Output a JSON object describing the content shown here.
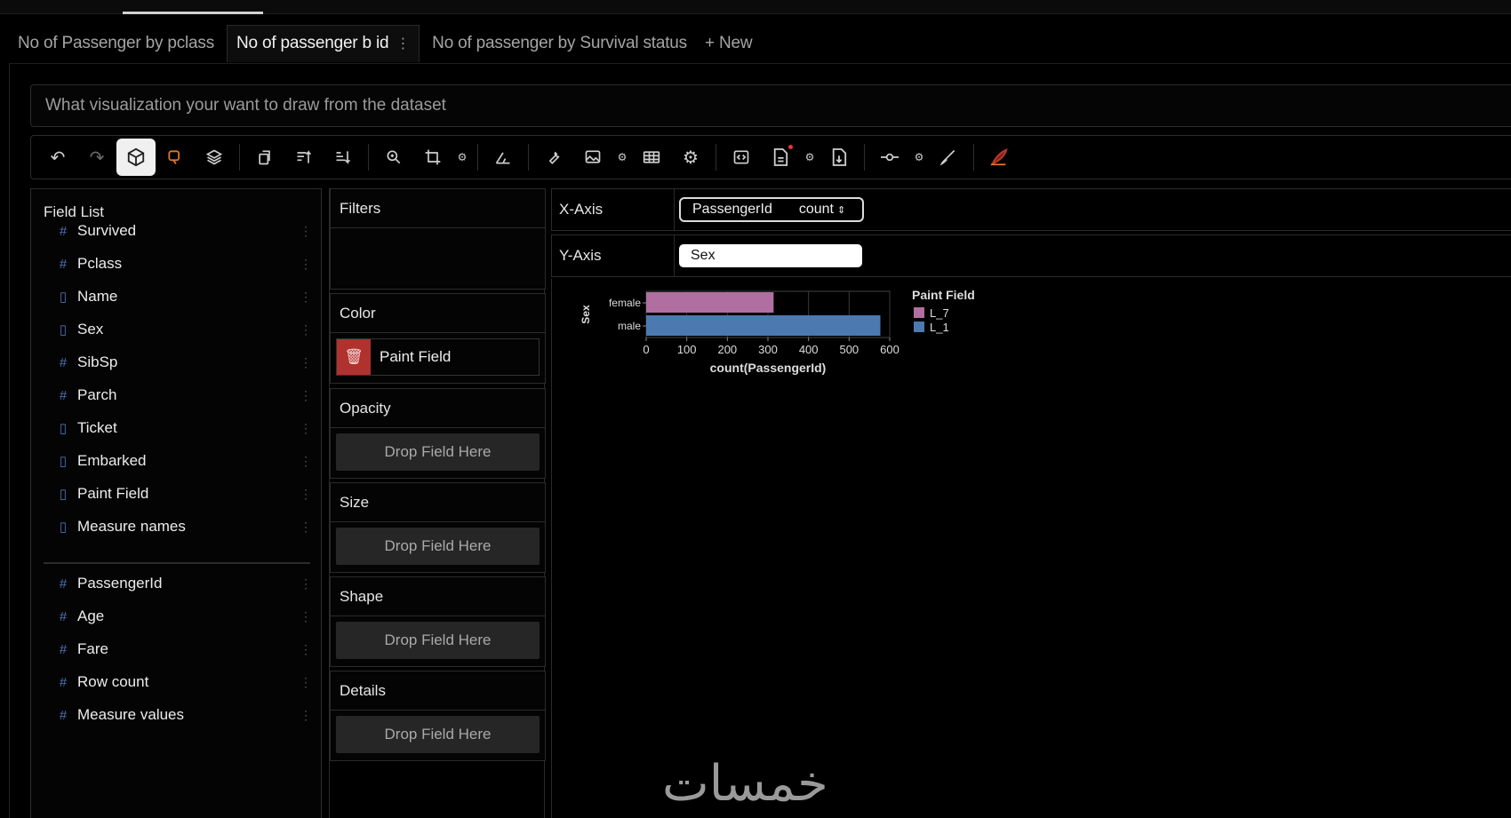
{
  "tabs": [
    {
      "label": "No of Passenger by pclass"
    },
    {
      "label": "No of passenger b id"
    },
    {
      "label": "No of passenger by Survival status"
    },
    {
      "label": "+ New"
    }
  ],
  "query": {
    "placeholder": "What visualization your want to draw from the dataset"
  },
  "toolbar": {
    "icons": [
      "undo-icon",
      "redo-icon",
      "cube-icon",
      "lasso-icon",
      "layers-icon",
      "transpose-icon",
      "sort-ascending-icon",
      "sort-descending-icon",
      "zoom-icon",
      "crop-icon",
      "axis-icon",
      "wrench-icon",
      "image-icon",
      "table-icon",
      "gear-icon",
      "code-icon",
      "export-file-icon",
      "download-file-icon",
      "line-icon",
      "paint-brush-icon",
      "feather-icon"
    ]
  },
  "field_list": {
    "title": "Field List",
    "dimensions": [
      {
        "label": "Survived",
        "icon": "hash"
      },
      {
        "label": "Pclass",
        "icon": "hash"
      },
      {
        "label": "Name",
        "icon": "doc"
      },
      {
        "label": "Sex",
        "icon": "doc"
      },
      {
        "label": "SibSp",
        "icon": "hash"
      },
      {
        "label": "Parch",
        "icon": "hash"
      },
      {
        "label": "Ticket",
        "icon": "doc"
      },
      {
        "label": "Embarked",
        "icon": "doc"
      },
      {
        "label": "Paint Field",
        "icon": "doc"
      },
      {
        "label": "Measure names",
        "icon": "doc"
      }
    ],
    "measures": [
      {
        "label": "PassengerId",
        "icon": "hash"
      },
      {
        "label": "Age",
        "icon": "hash"
      },
      {
        "label": "Fare",
        "icon": "hash"
      },
      {
        "label": "Row count",
        "icon": "hash"
      },
      {
        "label": "Measure values",
        "icon": "hash"
      }
    ]
  },
  "encodings": {
    "filters": "Filters",
    "color": "Color",
    "color_field": "Paint Field",
    "opacity": "Opacity",
    "size": "Size",
    "shape": "Shape",
    "details": "Details",
    "drop_text": "Drop Field Here"
  },
  "axes": {
    "x_label": "X-Axis",
    "x_field": "PassengerId",
    "x_agg": "count",
    "y_label": "Y-Axis",
    "y_field": "Sex"
  },
  "chart_data": {
    "type": "bar",
    "orientation": "horizontal",
    "categories": [
      "female",
      "male"
    ],
    "series": [
      {
        "name": "L_7",
        "values": [
          314,
          0
        ],
        "color": "#b06fa0"
      },
      {
        "name": "L_1",
        "values": [
          0,
          577
        ],
        "color": "#4c79b0"
      }
    ],
    "xlabel": "count(PassengerId)",
    "ylabel": "Sex",
    "xlim": [
      0,
      600
    ],
    "xticks": [
      "0",
      "100",
      "200",
      "300",
      "400",
      "500",
      "600"
    ],
    "legend_title": "Paint Field",
    "legend_position": "right",
    "grid": true
  },
  "watermark": "خمسات"
}
